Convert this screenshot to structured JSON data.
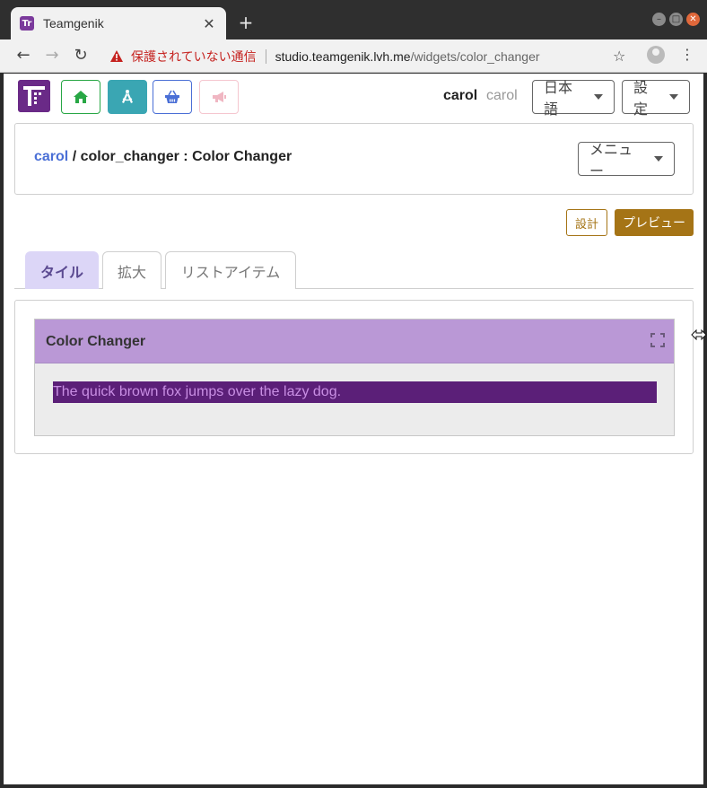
{
  "browser": {
    "tab_title": "Teamgenik",
    "tab_favicon_letter": "Tr",
    "security_label": "保護されていない通信",
    "url_host": "studio.teamgenik.lvh.me",
    "url_path": "/widgets/color_changer"
  },
  "nav": {
    "user_name": "carol",
    "user_handle": "carol",
    "language_label": "日本語",
    "settings_label": "設定"
  },
  "header": {
    "owner": "carol",
    "separator": " / ",
    "widget_id_name": "color_changer : Color Changer",
    "menu_label": "メニュー"
  },
  "actions": {
    "design_label": "設計",
    "preview_label": "プレビュー"
  },
  "tabs": [
    {
      "label": "タイル",
      "active": true
    },
    {
      "label": "拡大",
      "active": false
    },
    {
      "label": "リストアイテム",
      "active": false
    }
  ],
  "widget": {
    "title": "Color Changer",
    "demo_text": "The quick brown fox jumps over the lazy dog."
  },
  "colors": {
    "brand": "#6a2a87",
    "widget_header": "#ba98d6",
    "demo_bg": "#5b1f78",
    "demo_fg": "#c88ee3",
    "accent_gold": "#a57416"
  }
}
